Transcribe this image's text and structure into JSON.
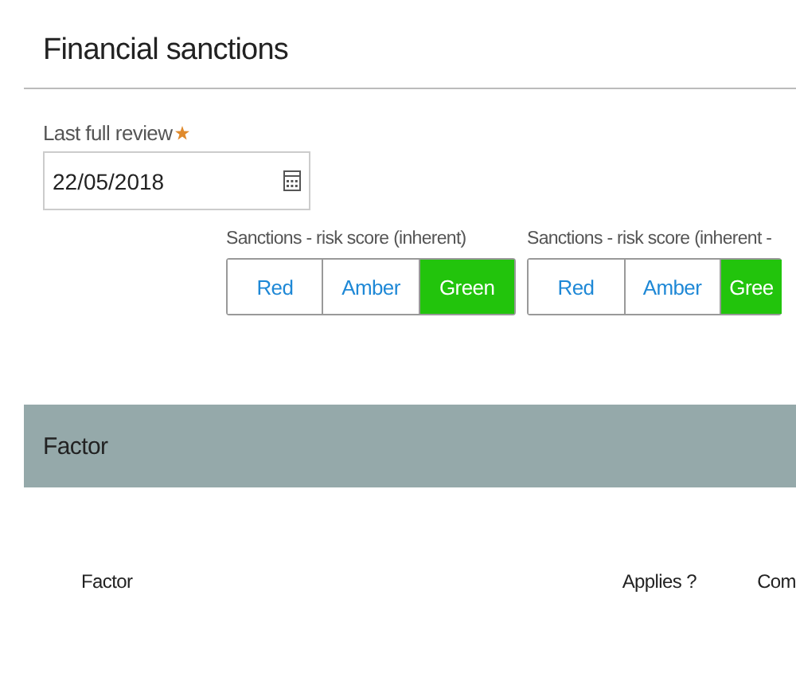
{
  "section": {
    "title": "Financial sanctions"
  },
  "review": {
    "label": "Last full review",
    "required": true,
    "value": "22/05/2018"
  },
  "rating_groups": [
    {
      "label": "Sanctions - risk score (inherent)",
      "options": [
        {
          "label": "Red",
          "selected": false
        },
        {
          "label": "Amber",
          "selected": false
        },
        {
          "label": "Green",
          "selected": true
        }
      ]
    },
    {
      "label": "Sanctions - risk score (inherent -",
      "options": [
        {
          "label": "Red",
          "selected": false
        },
        {
          "label": "Amber",
          "selected": false
        },
        {
          "label": "Gree",
          "selected": true
        }
      ]
    }
  ],
  "factor_panel": {
    "title": "Factor"
  },
  "table": {
    "columns": [
      "Factor",
      "Applies ?",
      "Com"
    ]
  }
}
